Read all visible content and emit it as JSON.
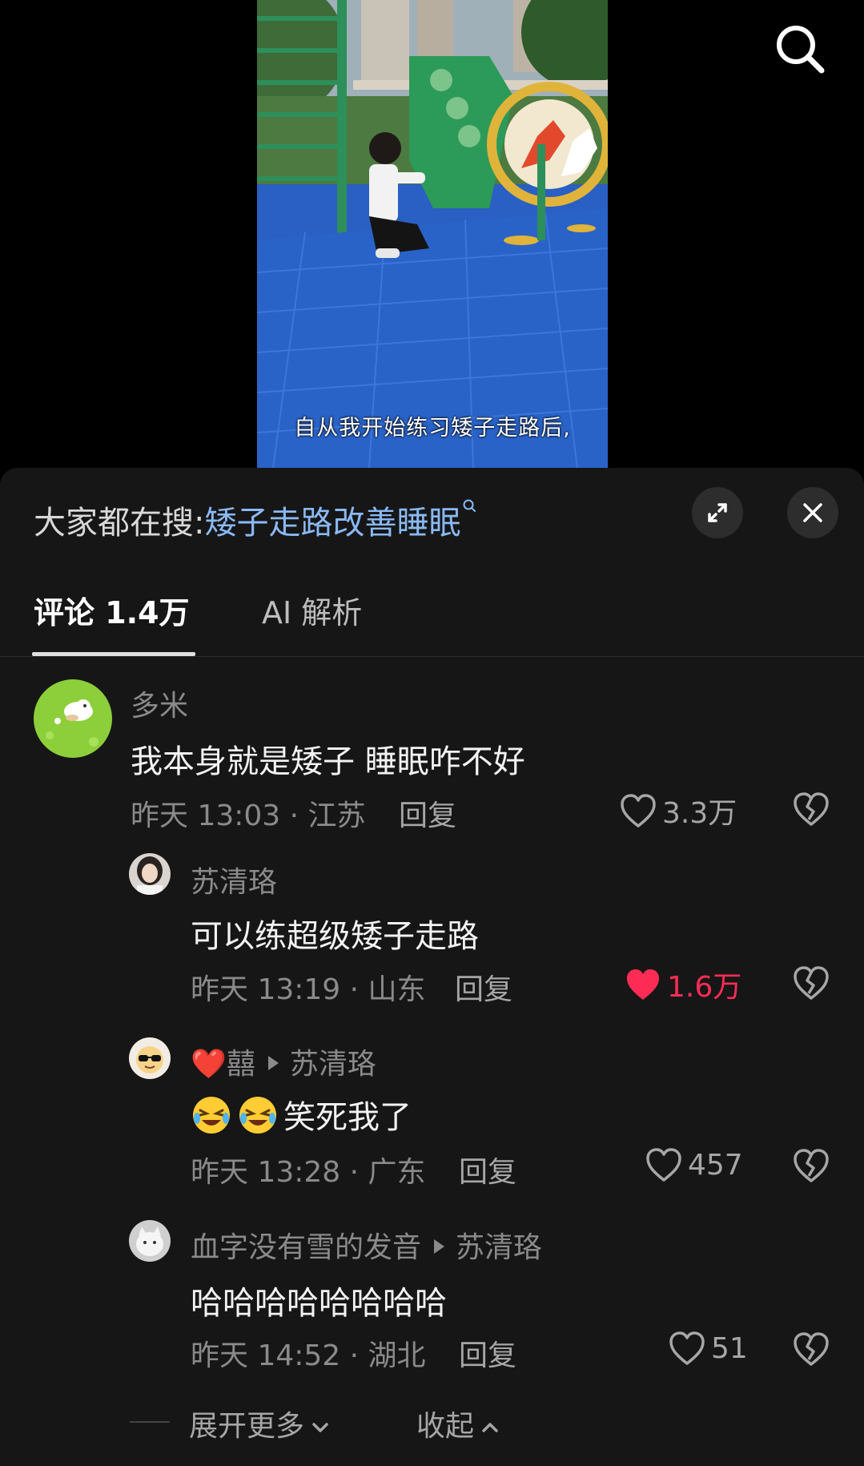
{
  "video": {
    "subtitle": "自从我开始练习矮子走路后,"
  },
  "panel": {
    "search_prefix": "大家都在搜:",
    "search_keyword": "矮子走路改善睡眠",
    "tabs": [
      {
        "label": "评论 1.4万",
        "active": true
      },
      {
        "label": "AI 解析",
        "active": false
      }
    ]
  },
  "comments": [
    {
      "name": "多米",
      "text": "我本身就是矮子 睡眠咋不好",
      "time_location": "昨天 13:03 · 江苏",
      "reply_label": "回复",
      "likes": "3.3万",
      "liked": false
    },
    {
      "name": "苏清珞",
      "text": "可以练超级矮子走路",
      "time_location": "昨天 13:19 · 山东",
      "reply_label": "回复",
      "likes": "1.6万",
      "liked": true
    },
    {
      "name_prefix_emoji": "❤️",
      "name": "囍",
      "reply_to": "苏清珞",
      "text": "笑死我了",
      "emoji_name": "rolling-laughing-emoji",
      "time_location": "昨天 13:28 · 广东",
      "reply_label": "回复",
      "likes": "457",
      "liked": false
    },
    {
      "name": "血字没有雪的发音",
      "reply_to": "苏清珞",
      "text": "哈哈哈哈哈哈哈哈",
      "time_location": "昨天 14:52 · 湖北",
      "reply_label": "回复",
      "likes": "51",
      "liked": false
    }
  ],
  "footer": {
    "expand_label": "展开更多",
    "collapse_label": "收起"
  },
  "colors": {
    "panel_bg": "#161616",
    "keyword": "#8ab9f5",
    "liked": "#fe2c55",
    "muted_text": "#8a8a8a"
  }
}
